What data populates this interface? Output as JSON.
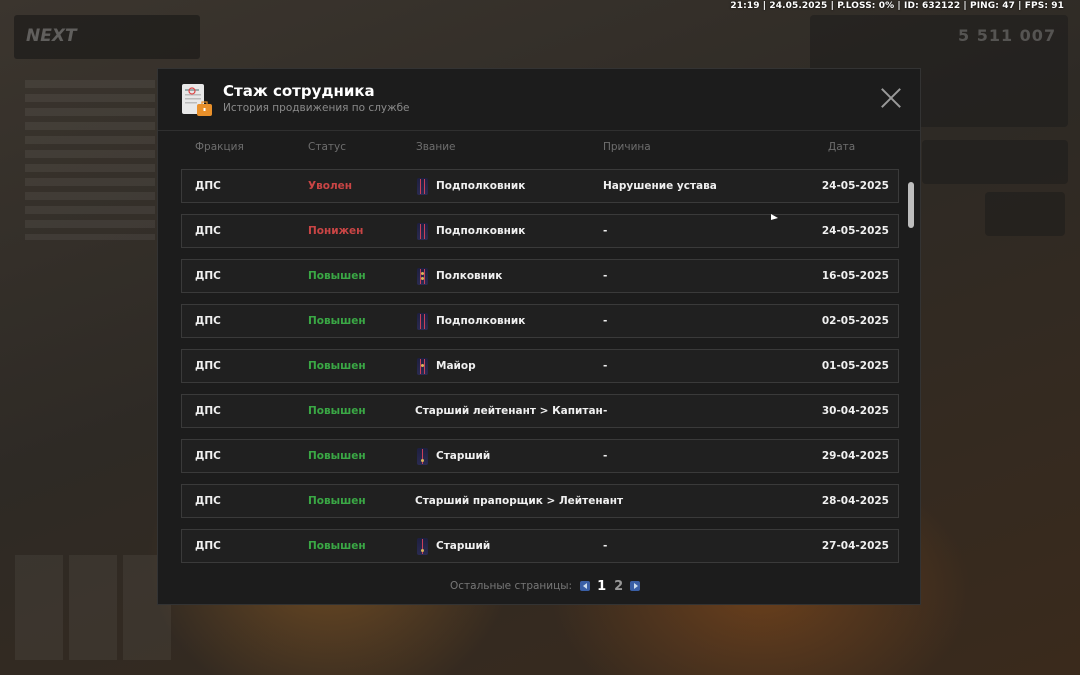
{
  "hud": {
    "stats": "21:19 | 24.05.2025 | P.LOSS: 0% | ID: 632122 | PING: 47 | FPS: 91",
    "money": "5 511 007",
    "logo": "NEXT"
  },
  "modal": {
    "title": "Стаж сотрудника",
    "subtitle": "История продвижения по службе"
  },
  "columns": {
    "faction": "Фракция",
    "status": "Статус",
    "rank": "Звание",
    "reason": "Причина",
    "date": "Дата"
  },
  "rows": [
    {
      "faction": "ДПС",
      "status": "Уволен",
      "status_color": "red",
      "rank": "Подполковник",
      "rank_icon": "epaulet-lt-colonel",
      "reason": "Нарушение устава",
      "date": "24-05-2025"
    },
    {
      "faction": "ДПС",
      "status": "Понижен",
      "status_color": "red",
      "rank": "Подполковник",
      "rank_icon": "epaulet-lt-colonel",
      "reason": "-",
      "date": "24-05-2025"
    },
    {
      "faction": "ДПС",
      "status": "Повышен",
      "status_color": "green",
      "rank": "Полковник",
      "rank_icon": "epaulet-colonel",
      "reason": "-",
      "date": "16-05-2025"
    },
    {
      "faction": "ДПС",
      "status": "Повышен",
      "status_color": "green",
      "rank": "Подполковник",
      "rank_icon": "epaulet-lt-colonel",
      "reason": "-",
      "date": "02-05-2025"
    },
    {
      "faction": "ДПС",
      "status": "Повышен",
      "status_color": "green",
      "rank": "Майор",
      "rank_icon": "epaulet-major",
      "reason": "-",
      "date": "01-05-2025"
    },
    {
      "faction": "ДПС",
      "status": "Повышен",
      "status_color": "green",
      "rank": "Старший лейтенант > Капитан",
      "rank_icon": "",
      "reason": "-",
      "date": "30-04-2025"
    },
    {
      "faction": "ДПС",
      "status": "Повышен",
      "status_color": "green",
      "rank": "Старший",
      "rank_icon": "epaulet-senior",
      "reason": "-",
      "date": "29-04-2025"
    },
    {
      "faction": "ДПС",
      "status": "Повышен",
      "status_color": "green",
      "rank": "Старший прапорщик > Лейтенант",
      "rank_icon": "",
      "reason": "-",
      "date": "28-04-2025"
    },
    {
      "faction": "ДПС",
      "status": "Повышен",
      "status_color": "green",
      "rank": "Старший",
      "rank_icon": "epaulet-senior",
      "reason": "-",
      "date": "27-04-2025"
    }
  ],
  "pagination": {
    "label": "Остальные страницы:",
    "pages": [
      "1",
      "2"
    ],
    "current": "1"
  },
  "colors": {
    "status_red": "#c94545",
    "status_green": "#3aa845",
    "panel": "#1c1c1c"
  }
}
